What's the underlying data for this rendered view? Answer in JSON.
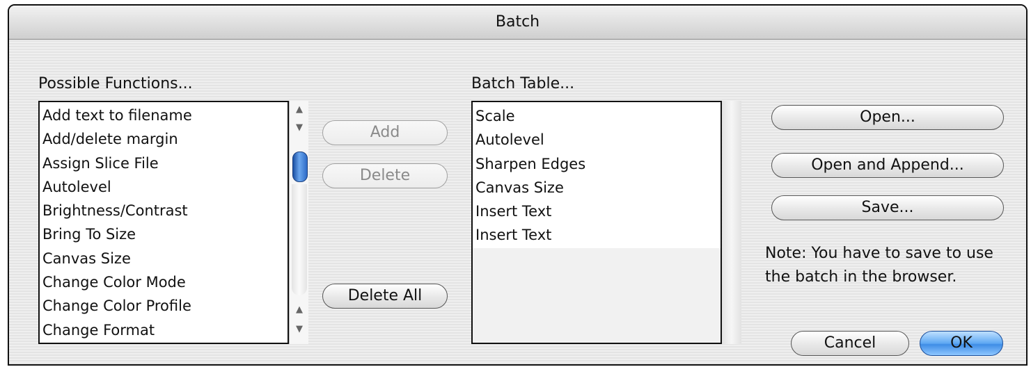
{
  "window": {
    "title": "Batch"
  },
  "possible_functions": {
    "label": "Possible Functions...",
    "items": [
      "Add text to filename",
      "Add/delete margin",
      "Assign Slice File",
      "Autolevel",
      "Brightness/Contrast",
      "Bring To Size",
      "Canvas Size",
      "Change Color Mode",
      "Change Color Profile",
      "Change Format"
    ]
  },
  "batch_table": {
    "label": "Batch Table...",
    "items": [
      "Scale",
      "Autolevel",
      "Sharpen Edges",
      "Canvas Size",
      "Insert Text",
      "Insert Text"
    ]
  },
  "buttons": {
    "add": "Add",
    "delete": "Delete",
    "delete_all": "Delete All",
    "open": "Open...",
    "open_and_append": "Open and Append...",
    "save": "Save...",
    "cancel": "Cancel",
    "ok": "OK"
  },
  "note": "Note: You have to save to use the batch in the browser.",
  "icons": {
    "scroll_up": "arrow-up",
    "scroll_down": "arrow-down"
  },
  "colors": {
    "default_button": "#5ea8f3",
    "scroll_thumb": "#2d6bc7"
  }
}
